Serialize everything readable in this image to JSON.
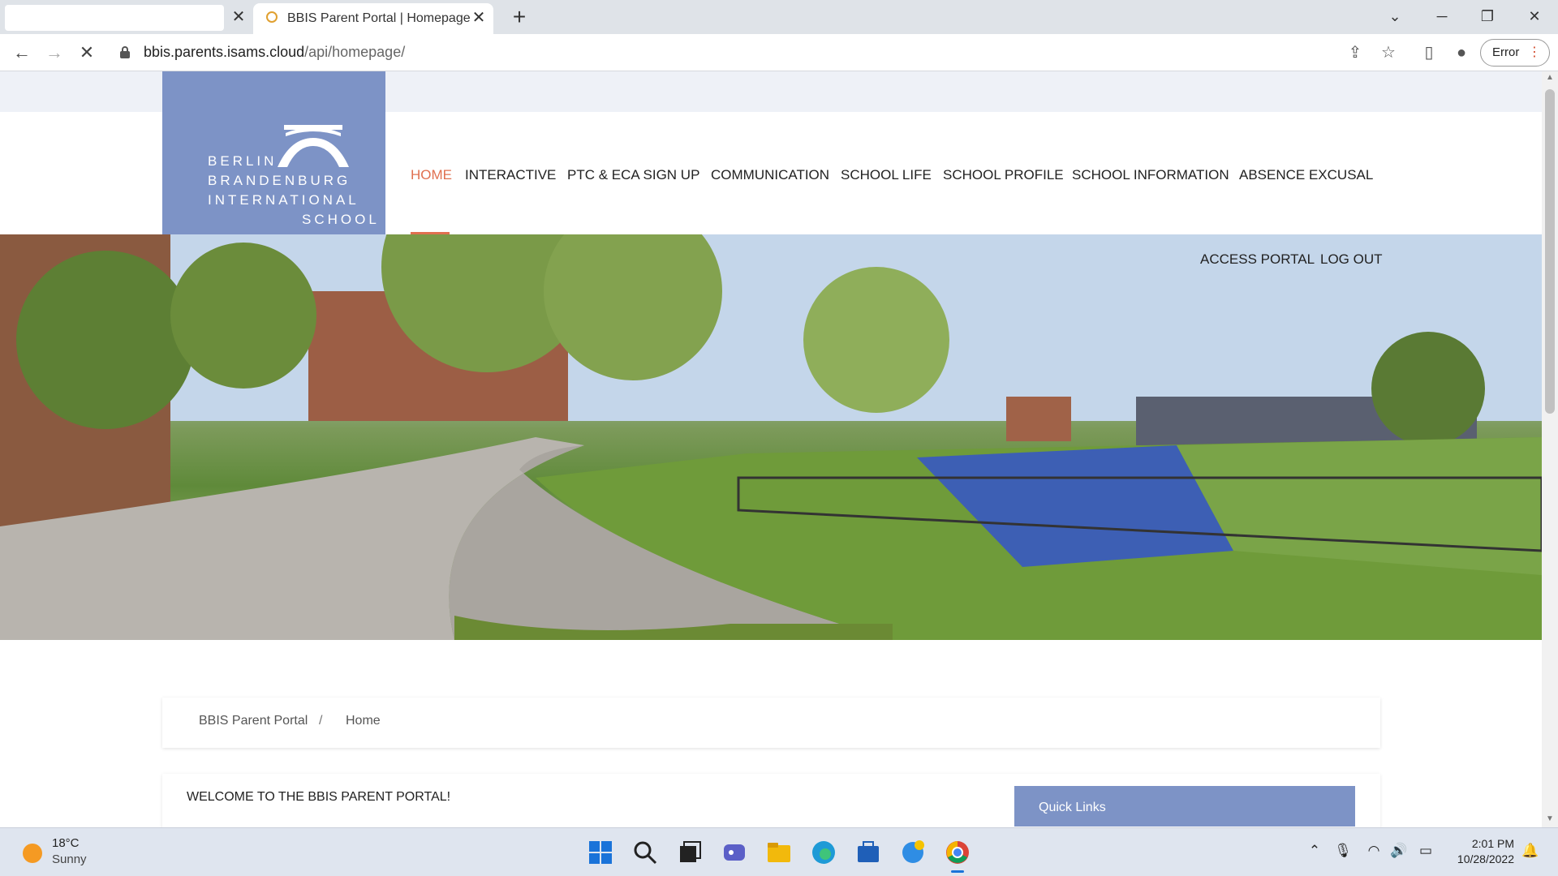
{
  "browser": {
    "active_tab_title": "BBIS Parent Portal | Homepage",
    "url_host": "bbis.parents.isams.cloud",
    "url_path": "/api/homepage/",
    "error_label": "Error"
  },
  "site": {
    "logo_lines": [
      "BERLIN",
      "BRANDENBURG",
      "INTERNATIONAL",
      "SCHOOL"
    ],
    "logo_color": "#7d93c6",
    "accent_color": "#e07050",
    "nav": [
      {
        "label": "HOME",
        "active": true
      },
      {
        "label": "INTERACTIVE"
      },
      {
        "label": "PTC & ECA SIGN UP"
      },
      {
        "label": "COMMUNICATION"
      },
      {
        "label": "SCHOOL LIFE"
      },
      {
        "label": "SCHOOL PROFILE"
      },
      {
        "label": "SCHOOL INFORMATION"
      },
      {
        "label": "ABSENCE EXCUSAL"
      }
    ],
    "access_portal": "ACCESS PORTAL",
    "logout": "LOG OUT",
    "breadcrumb": {
      "root": "BBIS Parent Portal",
      "separator": "/",
      "current": "Home"
    },
    "welcome": "WELCOME TO THE BBIS PARENT PORTAL!",
    "quick_links": "Quick Links"
  },
  "taskbar": {
    "weather_temp": "18°C",
    "weather_condition": "Sunny",
    "time": "2:01 PM",
    "date": "10/28/2022"
  }
}
